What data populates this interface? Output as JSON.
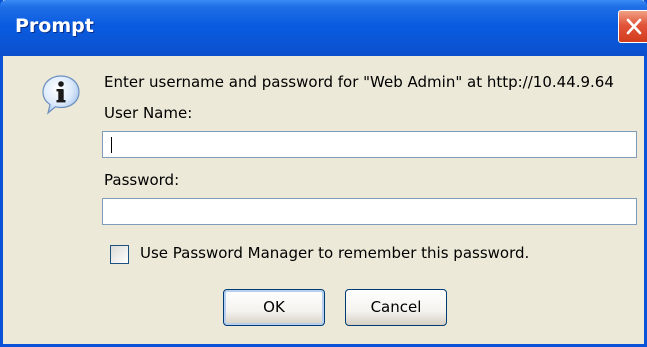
{
  "dialog": {
    "title": "Prompt",
    "message": "Enter username and password for \"Web Admin\" at http://10.44.9.64",
    "username_label": "User Name:",
    "username_value": "",
    "password_label": "Password:",
    "password_value": "",
    "remember_label": "Use Password Manager to remember this password.",
    "remember_checked": false,
    "ok_label": "OK",
    "cancel_label": "Cancel"
  },
  "icons": {
    "close": "close-icon",
    "info": "info-icon"
  },
  "colors": {
    "title_bar": "#0a5be0",
    "close_button": "#e2553a",
    "dialog_background": "#ece9d8",
    "field_border": "#7f9db9"
  }
}
